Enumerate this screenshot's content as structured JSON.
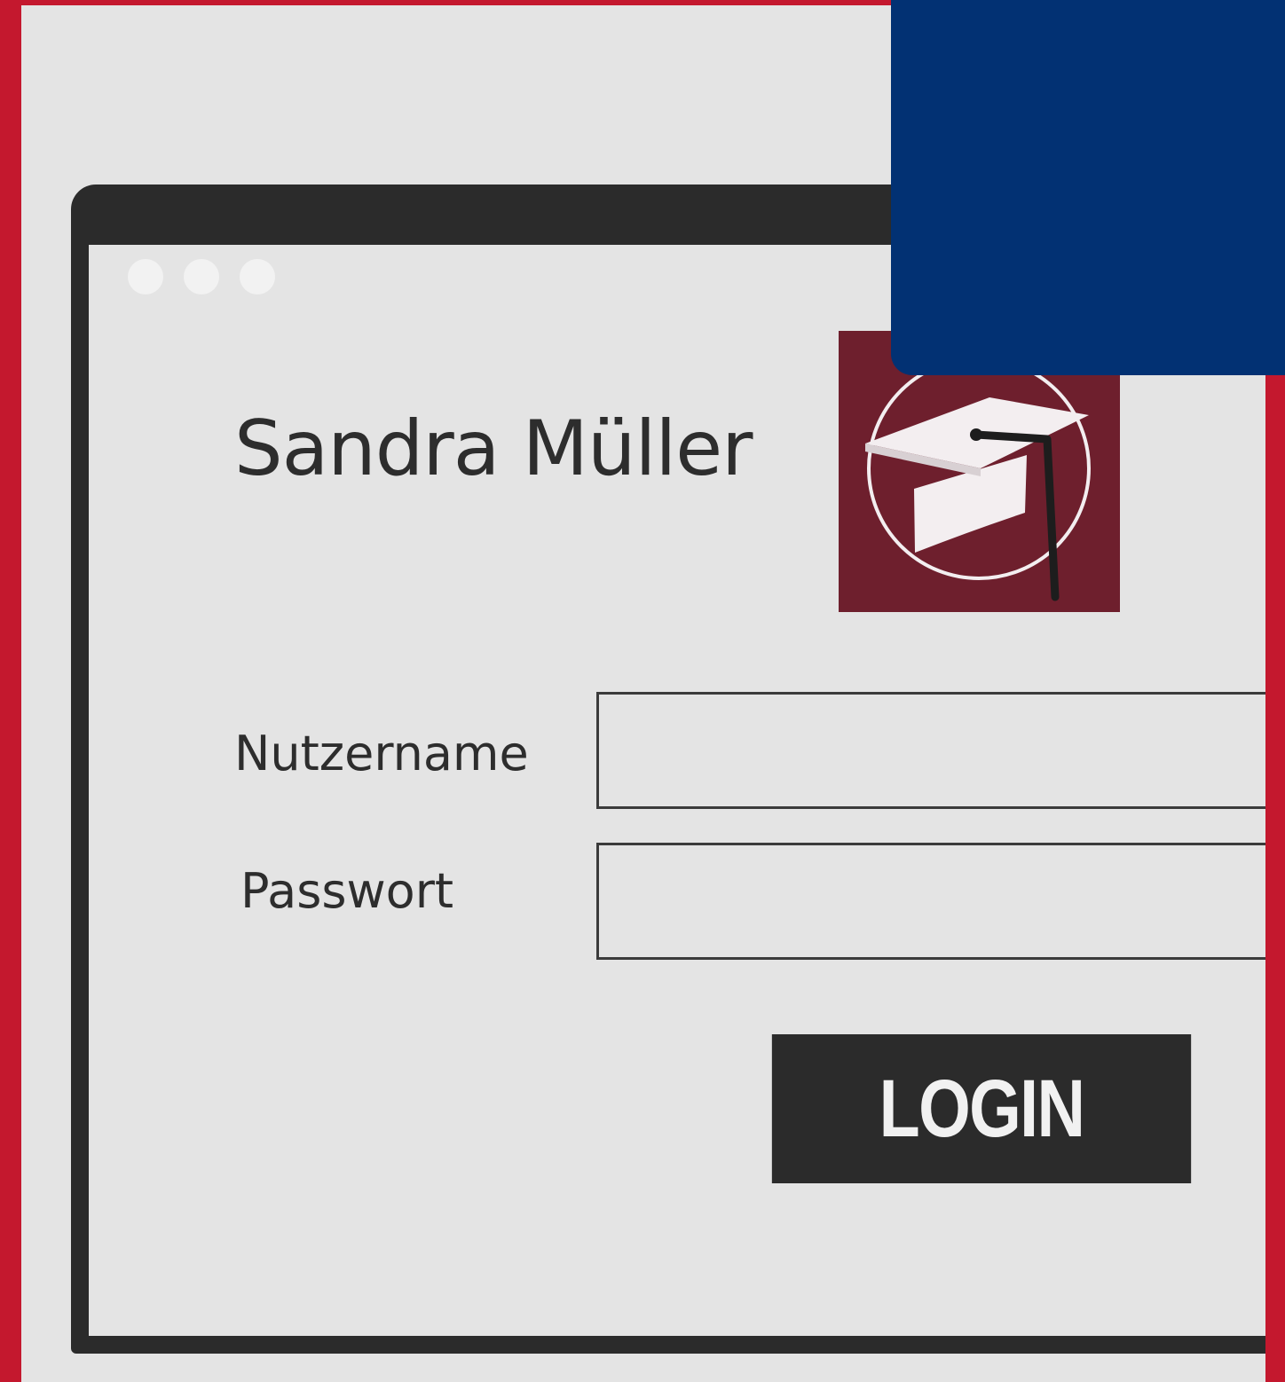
{
  "window": {
    "traffic_dots": 3
  },
  "profile": {
    "name": "Sandra Müller",
    "logo_icon": "graduation-cap-icon"
  },
  "form": {
    "username_label": "Nutzername",
    "password_label": "Passwort",
    "username_value": "",
    "password_value": "",
    "login_label": "LOGIN"
  },
  "colors": {
    "frame": "#c4182e",
    "panel": "#023173",
    "logo_bg": "#6e1f2d",
    "window_chrome": "#2b2b2b",
    "background": "#e4e4e4"
  }
}
